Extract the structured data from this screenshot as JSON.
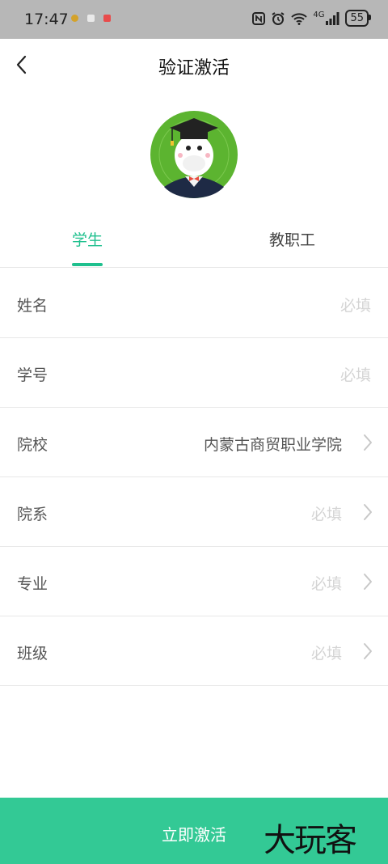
{
  "status_bar": {
    "time": "17:47",
    "battery": "55",
    "network": "4G"
  },
  "header": {
    "title": "验证激活"
  },
  "tabs": [
    {
      "label": "学生",
      "active": true
    },
    {
      "label": "教职工",
      "active": false
    }
  ],
  "form": {
    "rows": [
      {
        "label": "姓名",
        "value": "必填",
        "is_placeholder": true,
        "has_chevron": false
      },
      {
        "label": "学号",
        "value": "必填",
        "is_placeholder": true,
        "has_chevron": false
      },
      {
        "label": "院校",
        "value": "内蒙古商贸职业学院",
        "is_placeholder": false,
        "has_chevron": true
      },
      {
        "label": "院系",
        "value": "必填",
        "is_placeholder": true,
        "has_chevron": true
      },
      {
        "label": "专业",
        "value": "必填",
        "is_placeholder": true,
        "has_chevron": true
      },
      {
        "label": "班级",
        "value": "必填",
        "is_placeholder": true,
        "has_chevron": true
      }
    ]
  },
  "footer": {
    "activate_label": "立即激活",
    "watermark": "大玩客"
  },
  "colors": {
    "accent": "#1fc08e",
    "button": "#33c995",
    "placeholder": "#d4d4d4"
  }
}
